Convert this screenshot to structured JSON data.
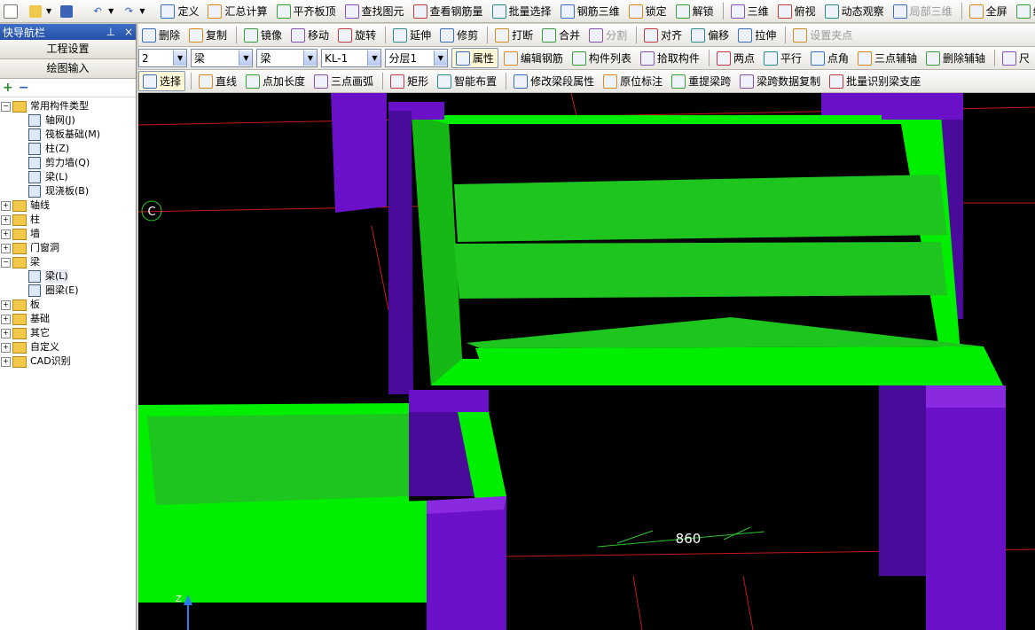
{
  "row1": [
    {
      "label": "定义",
      "icon": "define-icon"
    },
    {
      "label": "汇总计算",
      "icon": "sigma-icon"
    },
    {
      "label": "平齐板顶",
      "icon": "align-slab-icon"
    },
    {
      "label": "查找图元",
      "icon": "find-icon"
    },
    {
      "label": "查看钢筋量",
      "icon": "rebar-view-icon"
    },
    {
      "label": "批量选择",
      "icon": "batch-select-icon"
    },
    {
      "label": "钢筋三维",
      "icon": "rebar-3d-icon"
    },
    {
      "label": "锁定",
      "icon": "lock-icon"
    },
    {
      "label": "解锁",
      "icon": "unlock-icon"
    },
    {
      "label": "三维",
      "icon": "cube-icon"
    },
    {
      "label": "俯视",
      "icon": "top-view-icon"
    },
    {
      "label": "动态观察",
      "icon": "orbit-icon"
    },
    {
      "label": "局部三维",
      "icon": "local-3d-icon"
    },
    {
      "label": "全屏",
      "icon": "fullscreen-icon"
    },
    {
      "label": "缩放",
      "icon": "zoom-icon"
    }
  ],
  "row2": [
    {
      "label": "删除",
      "icon": "delete-icon"
    },
    {
      "label": "复制",
      "icon": "copy-icon"
    },
    {
      "label": "镜像",
      "icon": "mirror-icon"
    },
    {
      "label": "移动",
      "icon": "move-icon"
    },
    {
      "label": "旋转",
      "icon": "rotate-icon"
    },
    {
      "label": "延伸",
      "icon": "extend-icon"
    },
    {
      "label": "修剪",
      "icon": "trim-icon"
    },
    {
      "label": "打断",
      "icon": "break-icon"
    },
    {
      "label": "合并",
      "icon": "merge-icon"
    },
    {
      "label": "分割",
      "icon": "split-icon"
    },
    {
      "label": "对齐",
      "icon": "align-icon"
    },
    {
      "label": "偏移",
      "icon": "offset-icon"
    },
    {
      "label": "拉伸",
      "icon": "stretch-icon"
    },
    {
      "label": "设置夹点",
      "icon": "grip-icon"
    }
  ],
  "row3": {
    "floor_value": "2",
    "type1_value": "梁",
    "type2_value": "梁",
    "component_value": "KL-1",
    "layer_value": "分层1",
    "buttons": [
      {
        "label": "属性",
        "icon": "property-icon"
      },
      {
        "label": "编辑钢筋",
        "icon": "edit-rebar-icon"
      },
      {
        "label": "构件列表",
        "icon": "list-icon"
      },
      {
        "label": "拾取构件",
        "icon": "pick-icon"
      },
      {
        "label": "两点",
        "icon": "two-point-icon"
      },
      {
        "label": "平行",
        "icon": "parallel-icon"
      },
      {
        "label": "点角",
        "icon": "point-angle-icon"
      },
      {
        "label": "三点辅轴",
        "icon": "three-point-axis-icon"
      },
      {
        "label": "删除辅轴",
        "icon": "delete-axis-icon"
      },
      {
        "label": "尺",
        "icon": "ruler-icon"
      }
    ]
  },
  "row4": [
    {
      "label": "选择",
      "icon": "select-arrow-icon"
    },
    {
      "label": "直线",
      "icon": "line-icon"
    },
    {
      "label": "点加长度",
      "icon": "point-length-icon"
    },
    {
      "label": "三点画弧",
      "icon": "arc-icon"
    },
    {
      "label": "矩形",
      "icon": "rectangle-icon"
    },
    {
      "label": "智能布置",
      "icon": "smart-layout-icon"
    },
    {
      "label": "修改梁段属性",
      "icon": "beam-prop-icon"
    },
    {
      "label": "原位标注",
      "icon": "in-place-label-icon"
    },
    {
      "label": "重提梁跨",
      "icon": "beam-span-icon"
    },
    {
      "label": "梁跨数据复制",
      "icon": "span-copy-icon"
    },
    {
      "label": "批量识别梁支座",
      "icon": "support-icon"
    }
  ],
  "nav": {
    "title": "快导航栏",
    "pin": "⊥",
    "close": "×",
    "btn1": "工程设置",
    "btn2": "绘图输入",
    "tool_add": "+",
    "tool_remove": "−",
    "common": "常用构件类型",
    "common_children": [
      "轴网(J)",
      "筏板基础(M)",
      "柱(Z)",
      "剪力墙(Q)",
      "梁(L)",
      "现浇板(B)"
    ],
    "groups_before": [
      "轴线",
      "柱",
      "墙",
      "门窗洞"
    ],
    "beam_group": "梁",
    "beam_children": [
      "梁(L)",
      "圈梁(E)"
    ],
    "groups_after": [
      "板",
      "基础",
      "其它",
      "自定义",
      "CAD识别"
    ]
  },
  "viewport": {
    "axis_label": "C",
    "dimension": "860",
    "colors": {
      "bg": "#000000",
      "beam": "#00ee00",
      "beam_dark": "#16b816",
      "column": "#6a10c8",
      "column_dark": "#4a0a9a",
      "grid": "#c81818"
    }
  }
}
